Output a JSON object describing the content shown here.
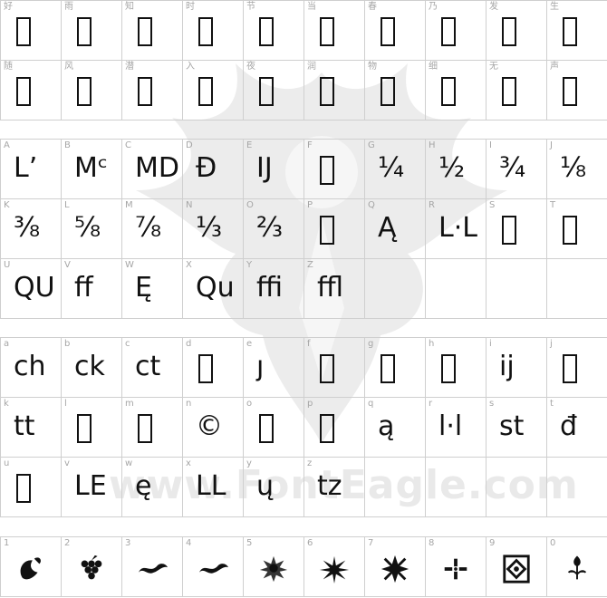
{
  "watermark": {
    "text": "www.FontEagle.com"
  },
  "sections": [
    {
      "id": "cjk",
      "rows": [
        [
          {
            "label": "好",
            "glyph": ""
          },
          {
            "label": "雨",
            "glyph": ""
          },
          {
            "label": "知",
            "glyph": ""
          },
          {
            "label": "时",
            "glyph": ""
          },
          {
            "label": "节",
            "glyph": ""
          },
          {
            "label": "当",
            "glyph": ""
          },
          {
            "label": "春",
            "glyph": ""
          },
          {
            "label": "乃",
            "glyph": ""
          },
          {
            "label": "发",
            "glyph": ""
          },
          {
            "label": "生",
            "glyph": ""
          }
        ],
        [
          {
            "label": "随",
            "glyph": ""
          },
          {
            "label": "风",
            "glyph": ""
          },
          {
            "label": "潜",
            "glyph": ""
          },
          {
            "label": "入",
            "glyph": ""
          },
          {
            "label": "夜",
            "glyph": ""
          },
          {
            "label": "润",
            "glyph": ""
          },
          {
            "label": "物",
            "glyph": ""
          },
          {
            "label": "细",
            "glyph": ""
          },
          {
            "label": "无",
            "glyph": ""
          },
          {
            "label": "声",
            "glyph": ""
          }
        ]
      ]
    },
    {
      "id": "upper",
      "rows": [
        [
          {
            "label": "A",
            "glyph": "Lʼ"
          },
          {
            "label": "B",
            "glyph": "Mᶜ"
          },
          {
            "label": "C",
            "glyph": "MD"
          },
          {
            "label": "D",
            "glyph": "Đ"
          },
          {
            "label": "E",
            "glyph": "IJ"
          },
          {
            "label": "F",
            "glyph": ""
          },
          {
            "label": "G",
            "glyph": "¼"
          },
          {
            "label": "H",
            "glyph": "½"
          },
          {
            "label": "I",
            "glyph": "¾"
          },
          {
            "label": "J",
            "glyph": "⅛"
          }
        ],
        [
          {
            "label": "K",
            "glyph": "⅜"
          },
          {
            "label": "L",
            "glyph": "⅝"
          },
          {
            "label": "M",
            "glyph": "⅞"
          },
          {
            "label": "N",
            "glyph": "⅓"
          },
          {
            "label": "O",
            "glyph": "⅔"
          },
          {
            "label": "P",
            "glyph": ""
          },
          {
            "label": "Q",
            "glyph": "Ą"
          },
          {
            "label": "R",
            "glyph": "L·L"
          },
          {
            "label": "S",
            "glyph": ""
          },
          {
            "label": "T",
            "glyph": ""
          }
        ],
        [
          {
            "label": "U",
            "glyph": "QU"
          },
          {
            "label": "V",
            "glyph": "ff"
          },
          {
            "label": "W",
            "glyph": "Ę"
          },
          {
            "label": "X",
            "glyph": "Qu"
          },
          {
            "label": "Y",
            "glyph": "ffi"
          },
          {
            "label": "Z",
            "glyph": "ffl"
          },
          {
            "label": "",
            "glyph": ""
          },
          {
            "label": "",
            "glyph": ""
          },
          {
            "label": "",
            "glyph": ""
          },
          {
            "label": "",
            "glyph": ""
          }
        ]
      ]
    },
    {
      "id": "lower",
      "rows": [
        [
          {
            "label": "a",
            "glyph": "ch"
          },
          {
            "label": "b",
            "glyph": "ck"
          },
          {
            "label": "c",
            "glyph": "ct"
          },
          {
            "label": "d",
            "glyph": ""
          },
          {
            "label": "e",
            "glyph": "ȷ"
          },
          {
            "label": "f",
            "glyph": ""
          },
          {
            "label": "g",
            "glyph": ""
          },
          {
            "label": "h",
            "glyph": ""
          },
          {
            "label": "i",
            "glyph": "ij"
          },
          {
            "label": "j",
            "glyph": ""
          }
        ],
        [
          {
            "label": "k",
            "glyph": "tt"
          },
          {
            "label": "l",
            "glyph": ""
          },
          {
            "label": "m",
            "glyph": ""
          },
          {
            "label": "n",
            "glyph": "©"
          },
          {
            "label": "o",
            "glyph": ""
          },
          {
            "label": "p",
            "glyph": ""
          },
          {
            "label": "q",
            "glyph": "ą"
          },
          {
            "label": "r",
            "glyph": "l·l"
          },
          {
            "label": "s",
            "glyph": "st"
          },
          {
            "label": "t",
            "glyph": "đ"
          }
        ],
        [
          {
            "label": "u",
            "glyph": ""
          },
          {
            "label": "v",
            "glyph": "LE"
          },
          {
            "label": "w",
            "glyph": "ę"
          },
          {
            "label": "x",
            "glyph": "LL"
          },
          {
            "label": "y",
            "glyph": "ų"
          },
          {
            "label": "z",
            "glyph": "tz"
          },
          {
            "label": "",
            "glyph": ""
          },
          {
            "label": "",
            "glyph": ""
          },
          {
            "label": "",
            "glyph": ""
          },
          {
            "label": "",
            "glyph": ""
          }
        ]
      ]
    },
    {
      "id": "digits",
      "rows": [
        [
          {
            "label": "1",
            "icon": "leaf-ornament-icon"
          },
          {
            "label": "2",
            "icon": "grape-cluster-icon"
          },
          {
            "label": "3",
            "icon": "swash-ornament-icon"
          },
          {
            "label": "4",
            "icon": "swash-ornament-icon"
          },
          {
            "label": "5",
            "icon": "rosette-icon"
          },
          {
            "label": "6",
            "icon": "starburst-icon"
          },
          {
            "label": "7",
            "icon": "compass-star-icon"
          },
          {
            "label": "8",
            "icon": "dot-cross-icon"
          },
          {
            "label": "9",
            "icon": "framed-square-icon"
          },
          {
            "label": "0",
            "icon": "floral-sprig-icon"
          }
        ]
      ]
    }
  ]
}
